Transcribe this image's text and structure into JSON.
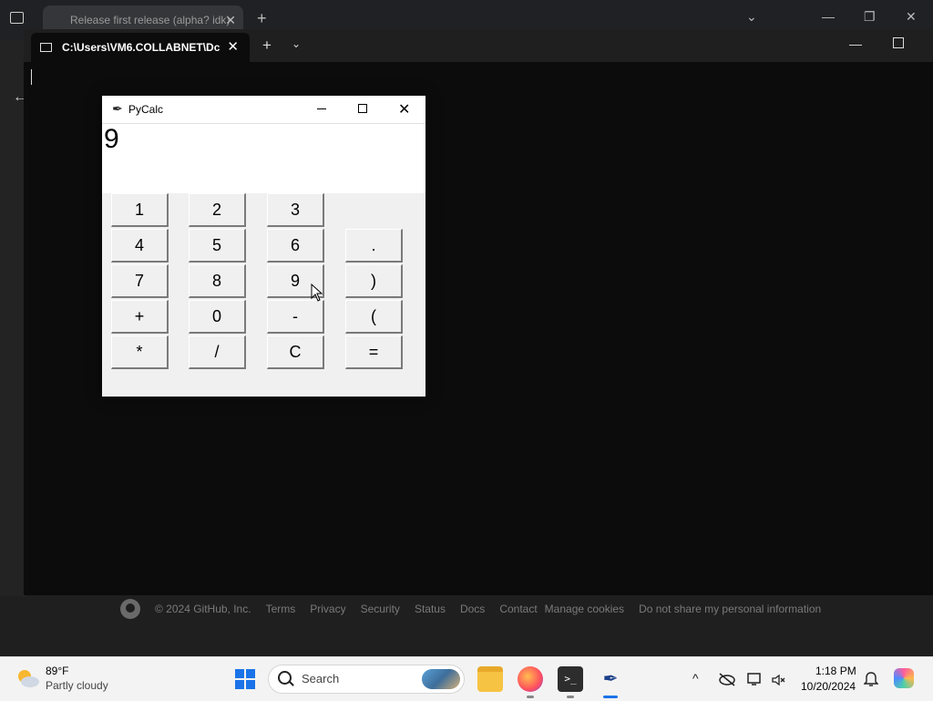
{
  "browser": {
    "tab_title": "Release first release (alpha? idk)",
    "close_glyph": "✕",
    "new_tab_glyph": "+",
    "dropdown_glyph": "⌄",
    "minimize_glyph": "—",
    "restore_glyph": "❐",
    "window_close_glyph": "✕",
    "back_glyph": "←"
  },
  "terminal": {
    "tab_title": "C:\\Users\\VM6.COLLABNET\\Dc",
    "close_glyph": "✕",
    "new_tab_glyph": "+",
    "dropdown_glyph": "⌄",
    "minimize_glyph": "—"
  },
  "github_footer": {
    "copyright": "© 2024 GitHub, Inc.",
    "links": [
      "Terms",
      "Privacy",
      "Security",
      "Status",
      "Docs",
      "Contact",
      "Manage cookies",
      "Do not share my personal information"
    ]
  },
  "pycalc": {
    "title": "PyCalc",
    "close_glyph": "✕",
    "display_value": "9",
    "keys": {
      "k1": "1",
      "k2": "2",
      "k3": "3",
      "k4": "4",
      "k5": "5",
      "k6": "6",
      "kdot": ".",
      "k7": "7",
      "k8": "8",
      "k9": "9",
      "krparen": ")",
      "kplus": "+",
      "k0": "0",
      "kminus": "-",
      "klparen": "(",
      "kmul": "*",
      "kdiv": "/",
      "kclear": "C",
      "keq": "="
    }
  },
  "taskbar": {
    "weather_temp": "89°F",
    "weather_desc": "Partly cloudy",
    "search_placeholder": "Search",
    "terminal_glyph": ">_",
    "feather_glyph": "✒",
    "tray_up": "^",
    "time": "1:18 PM",
    "date": "10/20/2024",
    "bell_glyph": "🔔"
  }
}
